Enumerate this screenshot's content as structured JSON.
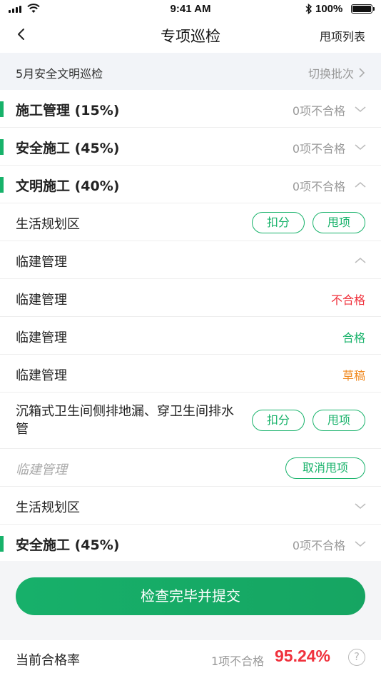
{
  "status_bar": {
    "time": "9:41 AM",
    "battery": "100%"
  },
  "nav": {
    "title": "专项巡检",
    "right_label": "甩项列表"
  },
  "batch": {
    "title": "5月安全文明巡检",
    "switch_label": "切换批次"
  },
  "rows": {
    "section1": {
      "label": "施工管理 (15%)",
      "count": "0项不合格"
    },
    "section2": {
      "label": "安全施工 (45%)",
      "count": "0项不合格"
    },
    "section3": {
      "label": "文明施工 (40%)",
      "count": "0项不合格"
    },
    "item1": {
      "label": "生活规划区",
      "btn_deduct": "扣分",
      "btn_skip": "甩项"
    },
    "group1": {
      "label": "临建管理"
    },
    "sub1": {
      "label": "临建管理",
      "status": "不合格"
    },
    "sub2": {
      "label": "临建管理",
      "status": "合格"
    },
    "sub3": {
      "label": "临建管理",
      "status": "草稿"
    },
    "item2": {
      "label": "沉箱式卫生间侧排地漏、穿卫生间排水管",
      "btn_deduct": "扣分",
      "btn_skip": "甩项"
    },
    "skipped": {
      "label": "临建管理",
      "btn_cancel": "取消甩项"
    },
    "group2": {
      "label": "生活规划区"
    },
    "section4": {
      "label": "安全施工 (45%)",
      "count": "0项不合格"
    }
  },
  "actions": {
    "submit_label": "检查完毕并提交"
  },
  "footer": {
    "label": "当前合格率",
    "fail_count": "1项不合格",
    "rate": "95.24%",
    "help": "?"
  },
  "colors": {
    "accent": "#17b26a",
    "danger": "#f0313c",
    "warning": "#f08a20"
  }
}
